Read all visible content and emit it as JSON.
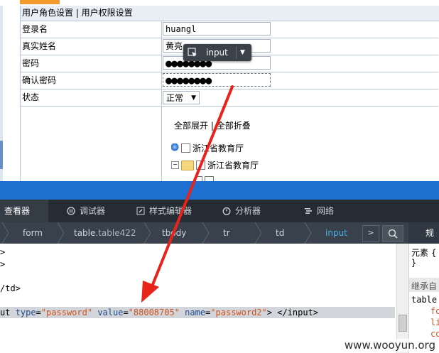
{
  "page": {
    "header": "用户角色设置 | 用户权限设置",
    "fields": [
      {
        "label": "登录名",
        "value": "huangl"
      },
      {
        "label": "真实姓名",
        "value": "黄亮"
      },
      {
        "label": "密码",
        "value": "●●●●●●●●"
      },
      {
        "label": "确认密码",
        "value": "●●●●●●●●"
      },
      {
        "label": "状态",
        "value": "正常"
      }
    ],
    "expand_all": "全部展开",
    "link_sep": "|",
    "collapse_all": "全部折叠",
    "tree": [
      {
        "label": "浙江省教育厅"
      },
      {
        "label": "浙江省教育厅"
      }
    ],
    "tooltip": {
      "text": "input"
    }
  },
  "devtools": {
    "tabs": [
      {
        "label": "查看器",
        "active": true
      },
      {
        "label": "调试器"
      },
      {
        "label": "样式编辑器"
      },
      {
        "label": "分析器"
      },
      {
        "label": "网络"
      }
    ],
    "breadcrumbs": [
      {
        "label": "form"
      },
      {
        "label": "table",
        "cls": ".table422"
      },
      {
        "label": "tbody"
      },
      {
        "label": "tr"
      },
      {
        "label": "td"
      },
      {
        "label": "input",
        "active": true
      }
    ],
    "rules_title": "规则",
    "markup_lines": [
      {
        "text": ">"
      },
      {
        "text": ">"
      },
      {
        "text": "/td>"
      }
    ],
    "selected_line": {
      "prefix": "ut ",
      "attr1": "type",
      "val1": "\"password\"",
      "attr2": "value",
      "val2": "\"88008705\"",
      "attr3": "name",
      "val3": "\"password2\"",
      "suffix": "> </input>"
    },
    "rules": {
      "element": "元素 {",
      "close": "}",
      "inherit": "继承自",
      "table_rule": "table {",
      "props": [
        "fo",
        "lin",
        "co"
      ]
    }
  },
  "watermark": "www.wooyun.org",
  "colors": {
    "accent": "#1d6fd0",
    "arrow": "#e8231a",
    "selected_crumb": "#46afe3"
  }
}
